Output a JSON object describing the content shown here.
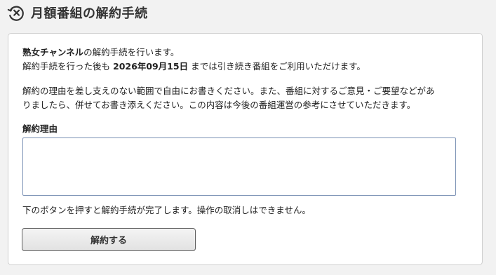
{
  "header": {
    "title": "月額番組の解約手続",
    "icon": "cancel-circle-icon"
  },
  "notice": {
    "channel_name": "熟女チャンネル",
    "line1_suffix": "の解約手続を行います。",
    "line2_prefix": "解約手続を行った後も",
    "end_date": "2026年09月15日",
    "line2_suffix": "までは引き続き番組をご利用いただけます。"
  },
  "instructions": {
    "line1": "解約の理由を差し支えのない範囲で自由にお書きください。また、番組に対するご意見・ご要望などがあ",
    "line2": "りましたら、併せてお書き添えください。この内容は今後の番組運営の参考にさせていただきます。"
  },
  "reason": {
    "label": "解約理由",
    "value": "",
    "placeholder": ""
  },
  "warning": "下のボタンを押すと解約手続が完了します。操作の取消しはできません。",
  "submit_label": "解約する"
}
